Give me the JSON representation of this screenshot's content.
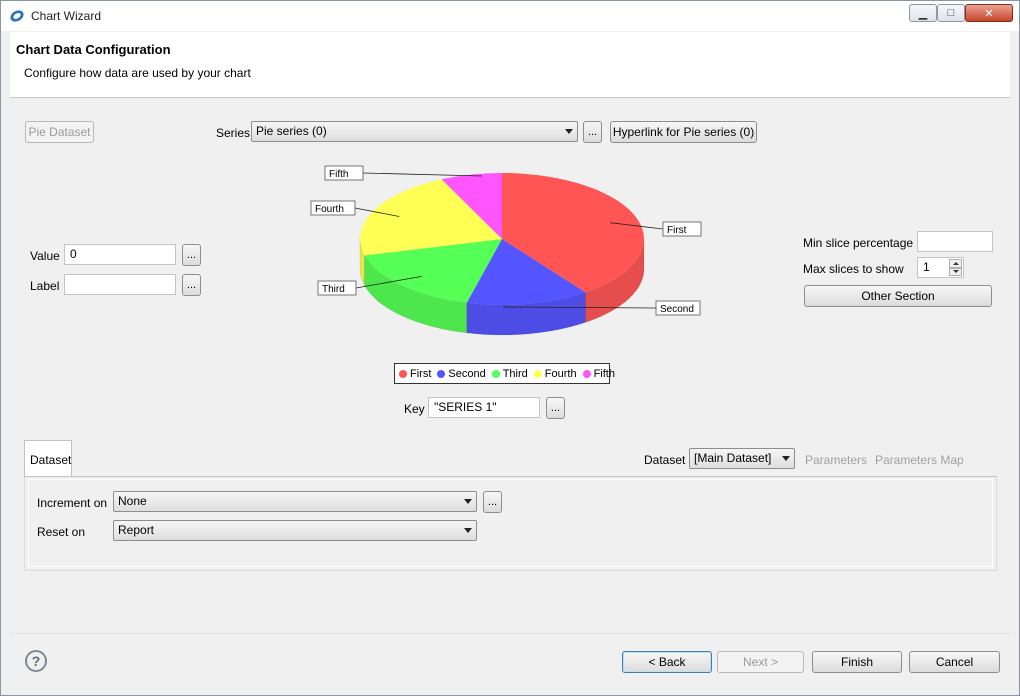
{
  "window": {
    "title": "Chart Wizard",
    "controls": {
      "minimize": "▁",
      "maximize": "□",
      "close": "✕"
    }
  },
  "header": {
    "title": "Chart Data Configuration",
    "description": "Configure how data are used by your chart"
  },
  "top_controls": {
    "pie_dataset_button": "Pie Dataset",
    "series_label": "Series",
    "series_value": "Pie series (0)",
    "series_ellipsis": "...",
    "hyperlink_button": "Hyperlink for Pie series (0)"
  },
  "left_fields": {
    "value_label": "Value",
    "value_value": "0",
    "value_ellipsis": "...",
    "label_label": "Label",
    "label_value": "",
    "label_ellipsis": "..."
  },
  "right_fields": {
    "min_slice_label": "Min slice percentage",
    "min_slice_value": "",
    "max_slices_label": "Max slices to show",
    "max_slices_value": "1",
    "other_section_button": "Other Section"
  },
  "chart_data": {
    "type": "pie",
    "categories": [
      "First",
      "Second",
      "Third",
      "Fourth",
      "Fifth"
    ],
    "values": [
      40,
      14,
      17,
      22,
      7
    ],
    "colors": [
      "#ff5555",
      "#5555ff",
      "#55ff55",
      "#ffff55",
      "#ff55ff"
    ],
    "legend": "bottom"
  },
  "key": {
    "label": "Key",
    "value": "\"SERIES 1\"",
    "ellipsis": "..."
  },
  "dataset_tab": {
    "tab_label": "Dataset",
    "dataset_label": "Dataset",
    "dataset_value": "[Main Dataset]",
    "parameters_link": "Parameters",
    "parameters_map_link": "Parameters Map",
    "increment_label": "Increment on",
    "increment_value": "None",
    "increment_ellipsis": "...",
    "reset_label": "Reset on",
    "reset_value": "Report"
  },
  "footer": {
    "help": "?",
    "back": "< Back",
    "next": "Next >",
    "finish": "Finish",
    "cancel": "Cancel"
  }
}
